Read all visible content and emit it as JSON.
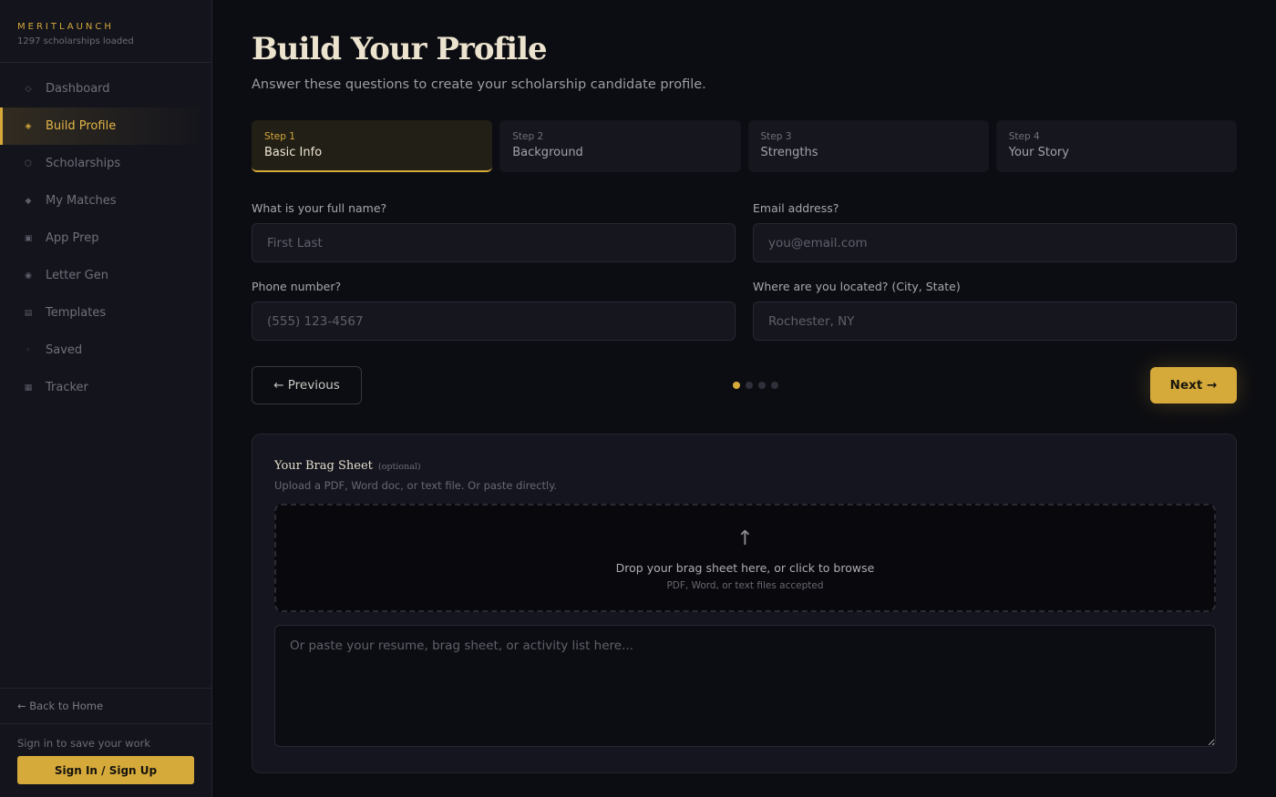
{
  "brand": {
    "name": "MERITLAUNCH",
    "subtitle": "1297 scholarships loaded"
  },
  "sidebar": {
    "items": [
      {
        "label": "Dashboard",
        "icon": "diamond-outline-icon",
        "glyph": "◇",
        "active": false
      },
      {
        "label": "Build Profile",
        "icon": "diamond-dot-icon",
        "glyph": "◈",
        "active": true
      },
      {
        "label": "Scholarships",
        "icon": "hexagon-icon",
        "glyph": "⬡",
        "active": false
      },
      {
        "label": "My Matches",
        "icon": "diamond-filled-icon",
        "glyph": "◆",
        "active": false
      },
      {
        "label": "App Prep",
        "icon": "square-target-icon",
        "glyph": "▣",
        "active": false
      },
      {
        "label": "Letter Gen",
        "icon": "circle-target-icon",
        "glyph": "◉",
        "active": false
      },
      {
        "label": "Templates",
        "icon": "list-icon",
        "glyph": "▤",
        "active": false
      },
      {
        "label": "Saved",
        "icon": "small-circle-icon",
        "glyph": "◦",
        "active": false
      },
      {
        "label": "Tracker",
        "icon": "grid-square-icon",
        "glyph": "▦",
        "active": false
      }
    ],
    "back_home": "← Back to Home",
    "signin_hint": "Sign in to save your work",
    "signin_button": "Sign In / Sign Up"
  },
  "page": {
    "title": "Build Your Profile",
    "subtitle": "Answer these questions to create your scholarship candidate profile."
  },
  "steps": [
    {
      "num": "Step 1",
      "name": "Basic Info",
      "active": true
    },
    {
      "num": "Step 2",
      "name": "Background",
      "active": false
    },
    {
      "num": "Step 3",
      "name": "Strengths",
      "active": false
    },
    {
      "num": "Step 4",
      "name": "Your Story",
      "active": false
    }
  ],
  "form": {
    "name": {
      "label": "What is your full name?",
      "placeholder": "First Last",
      "value": ""
    },
    "email": {
      "label": "Email address?",
      "placeholder": "you@email.com",
      "value": ""
    },
    "phone": {
      "label": "Phone number?",
      "placeholder": "(555) 123-4567",
      "value": ""
    },
    "location": {
      "label": "Where are you located? (City, State)",
      "placeholder": "Rochester, NY",
      "value": ""
    }
  },
  "nav_buttons": {
    "previous": "← Previous",
    "next": "Next →"
  },
  "progress": {
    "current_step": 1,
    "total_steps": 4
  },
  "brag_sheet": {
    "title": "Your Brag Sheet",
    "optional": "(optional)",
    "subtitle": "Upload a PDF, Word doc, or text file. Or paste directly.",
    "drop_arrow": "↑",
    "drop_main": "Drop your brag sheet here, or click to browse",
    "drop_sub": "PDF, Word, or text files accepted",
    "paste_placeholder": "Or paste your resume, brag sheet, or activity list here..."
  },
  "colors": {
    "accent": "#d6aa3a",
    "background": "#0c0d12",
    "sidebar": "#13141c",
    "card": "#14151e"
  }
}
